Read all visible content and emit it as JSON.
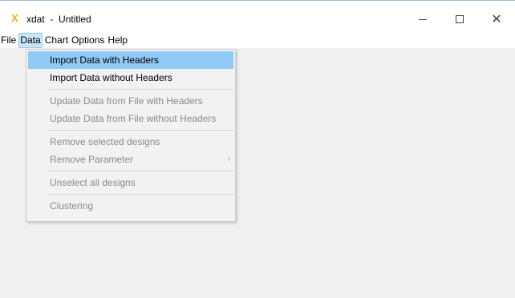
{
  "window": {
    "app_name": "xdat",
    "title_separator": "-",
    "document_name": "Untitled",
    "icon_glyph": "X",
    "icon_color": "#f0b400"
  },
  "title_controls": {
    "minimize_icon": "minimize-icon",
    "maximize_icon": "maximize-icon",
    "close_glyph": "✕"
  },
  "menubar": {
    "items": [
      {
        "label": "File",
        "active": false
      },
      {
        "label": "Data",
        "active": true
      },
      {
        "label": "Chart",
        "active": false
      },
      {
        "label": "Options",
        "active": false
      },
      {
        "label": "Help",
        "active": false
      }
    ]
  },
  "data_menu": {
    "groups": [
      [
        {
          "label": "Import Data with Headers",
          "enabled": true,
          "highlighted": true
        },
        {
          "label": "Import Data without Headers",
          "enabled": true,
          "highlighted": false
        }
      ],
      [
        {
          "label": "Update Data from File with Headers",
          "enabled": false,
          "highlighted": false
        },
        {
          "label": "Update Data from File without Headers",
          "enabled": false,
          "highlighted": false
        }
      ],
      [
        {
          "label": "Remove selected designs",
          "enabled": false,
          "highlighted": false
        },
        {
          "label": "Remove Parameter",
          "enabled": false,
          "highlighted": false,
          "submenu_arrow": "›"
        }
      ],
      [
        {
          "label": "Unselect all designs",
          "enabled": false,
          "highlighted": false
        }
      ],
      [
        {
          "label": "Clustering",
          "enabled": false,
          "highlighted": false
        }
      ]
    ]
  },
  "colors": {
    "highlight": "#91c9f7",
    "menubar_active_bg": "#cce4f7",
    "disabled_text": "#8a8a8a",
    "client_bg": "#f0f0f0"
  }
}
